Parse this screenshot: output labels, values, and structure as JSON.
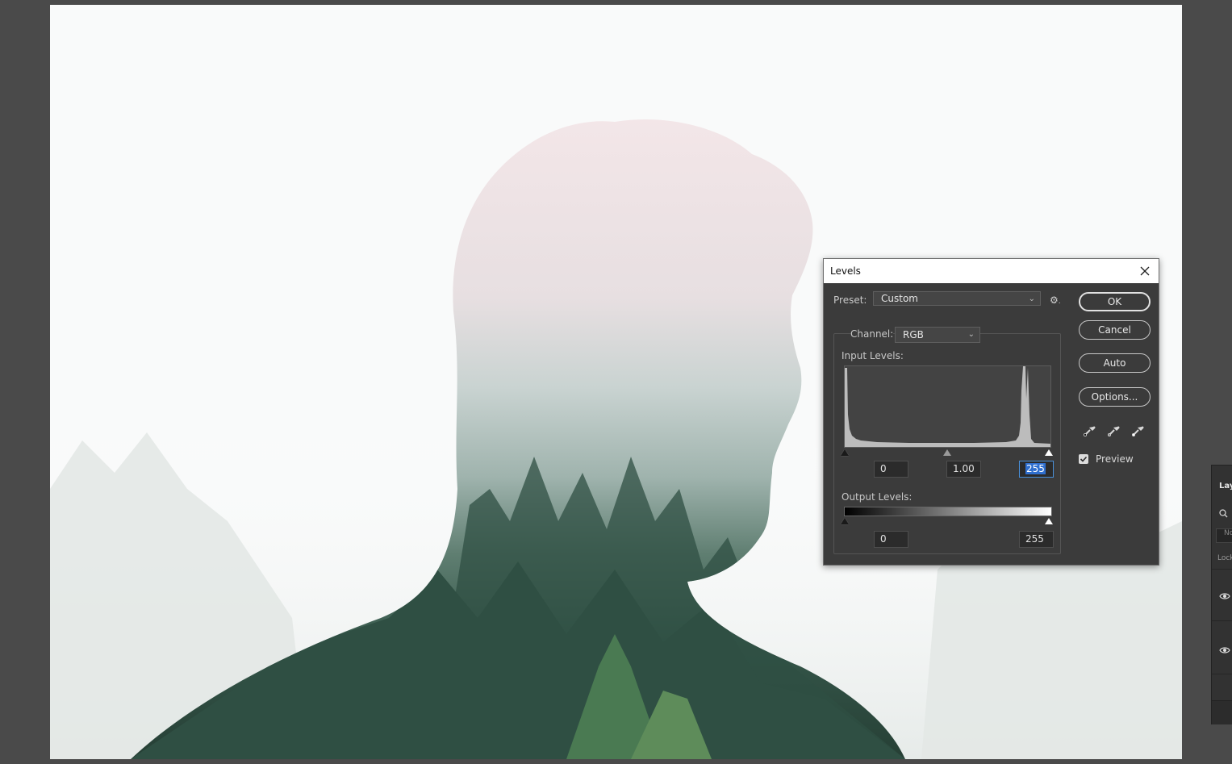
{
  "dialog": {
    "title": "Levels",
    "preset_label": "Preset:",
    "preset_value": "Custom",
    "channel_label": "Channel:",
    "channel_value": "RGB",
    "input_levels_label": "Input Levels:",
    "output_levels_label": "Output Levels:",
    "input_black": "0",
    "input_gamma": "1.00",
    "input_white": "255",
    "output_black": "0",
    "output_white": "255",
    "buttons": {
      "ok": "OK",
      "cancel": "Cancel",
      "auto": "Auto",
      "options": "Options..."
    },
    "preview_label": "Preview",
    "preview_checked": true
  },
  "layers_panel": {
    "tab_label": "Lay",
    "kind_placeholder": "No",
    "lock_label": "Lock"
  },
  "colors": {
    "dialog_bg": "#3b3b3b",
    "canvas_bg": "#f8f9f9",
    "workspace_bg": "#4a4a4a",
    "forest_dark": "#2c4a3e"
  },
  "icons": [
    "close-icon",
    "gear-icon",
    "black-eyedropper-icon",
    "gray-eyedropper-icon",
    "white-eyedropper-icon",
    "checkmark-icon",
    "eye-icon",
    "search-icon"
  ]
}
